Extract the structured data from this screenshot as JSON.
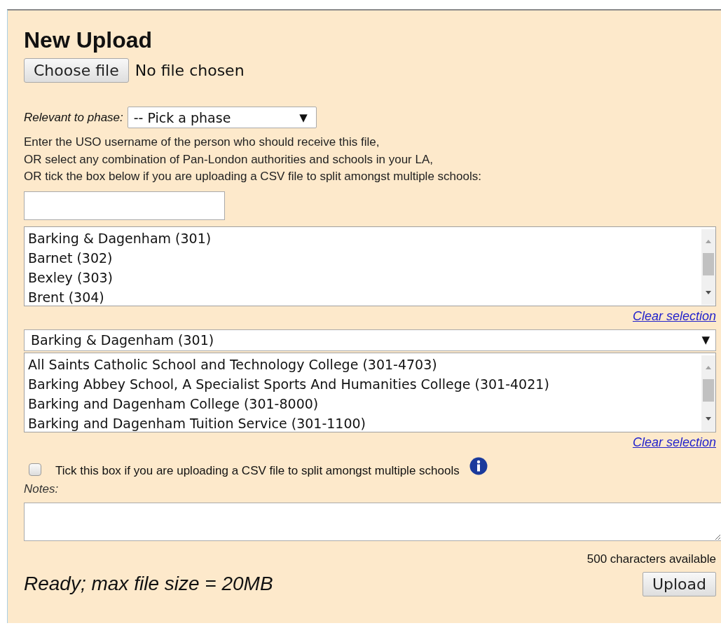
{
  "heading": "New Upload",
  "file_input": {
    "button": "Choose file",
    "status": "No file chosen"
  },
  "phase": {
    "label": "Relevant to phase:",
    "value": "-- Pick a phase",
    "arrow": "▼"
  },
  "instructions": [
    "Enter the USO username of the person who should receive this file,",
    "OR select any combination of Pan-London authorities and schools in your LA,",
    "OR tick the box below if you are uploading a CSV file to split amongst multiple schools:"
  ],
  "authorities": {
    "items": [
      "Barking & Dagenham (301)",
      "Barnet (302)",
      "Bexley (303)",
      "Brent (304)"
    ],
    "clear_link": "Clear selection"
  },
  "authority_filter": {
    "value": "Barking & Dagenham (301)",
    "arrow": "▼"
  },
  "schools": {
    "items": [
      "All Saints Catholic School and Technology College (301-4703)",
      "Barking Abbey School, A Specialist Sports And Humanities College (301-4021)",
      "Barking and Dagenham College (301-8000)",
      "Barking and Dagenham Tuition Service (301-1100)"
    ],
    "clear_link": "Clear selection"
  },
  "csv_split": {
    "label": "Tick this box if you are uploading a CSV file to split amongst multiple schools",
    "checked": false
  },
  "notes": {
    "label": "Notes:",
    "counter": "500 characters available"
  },
  "status": "Ready; max file size = 20MB",
  "upload_button": "Upload"
}
